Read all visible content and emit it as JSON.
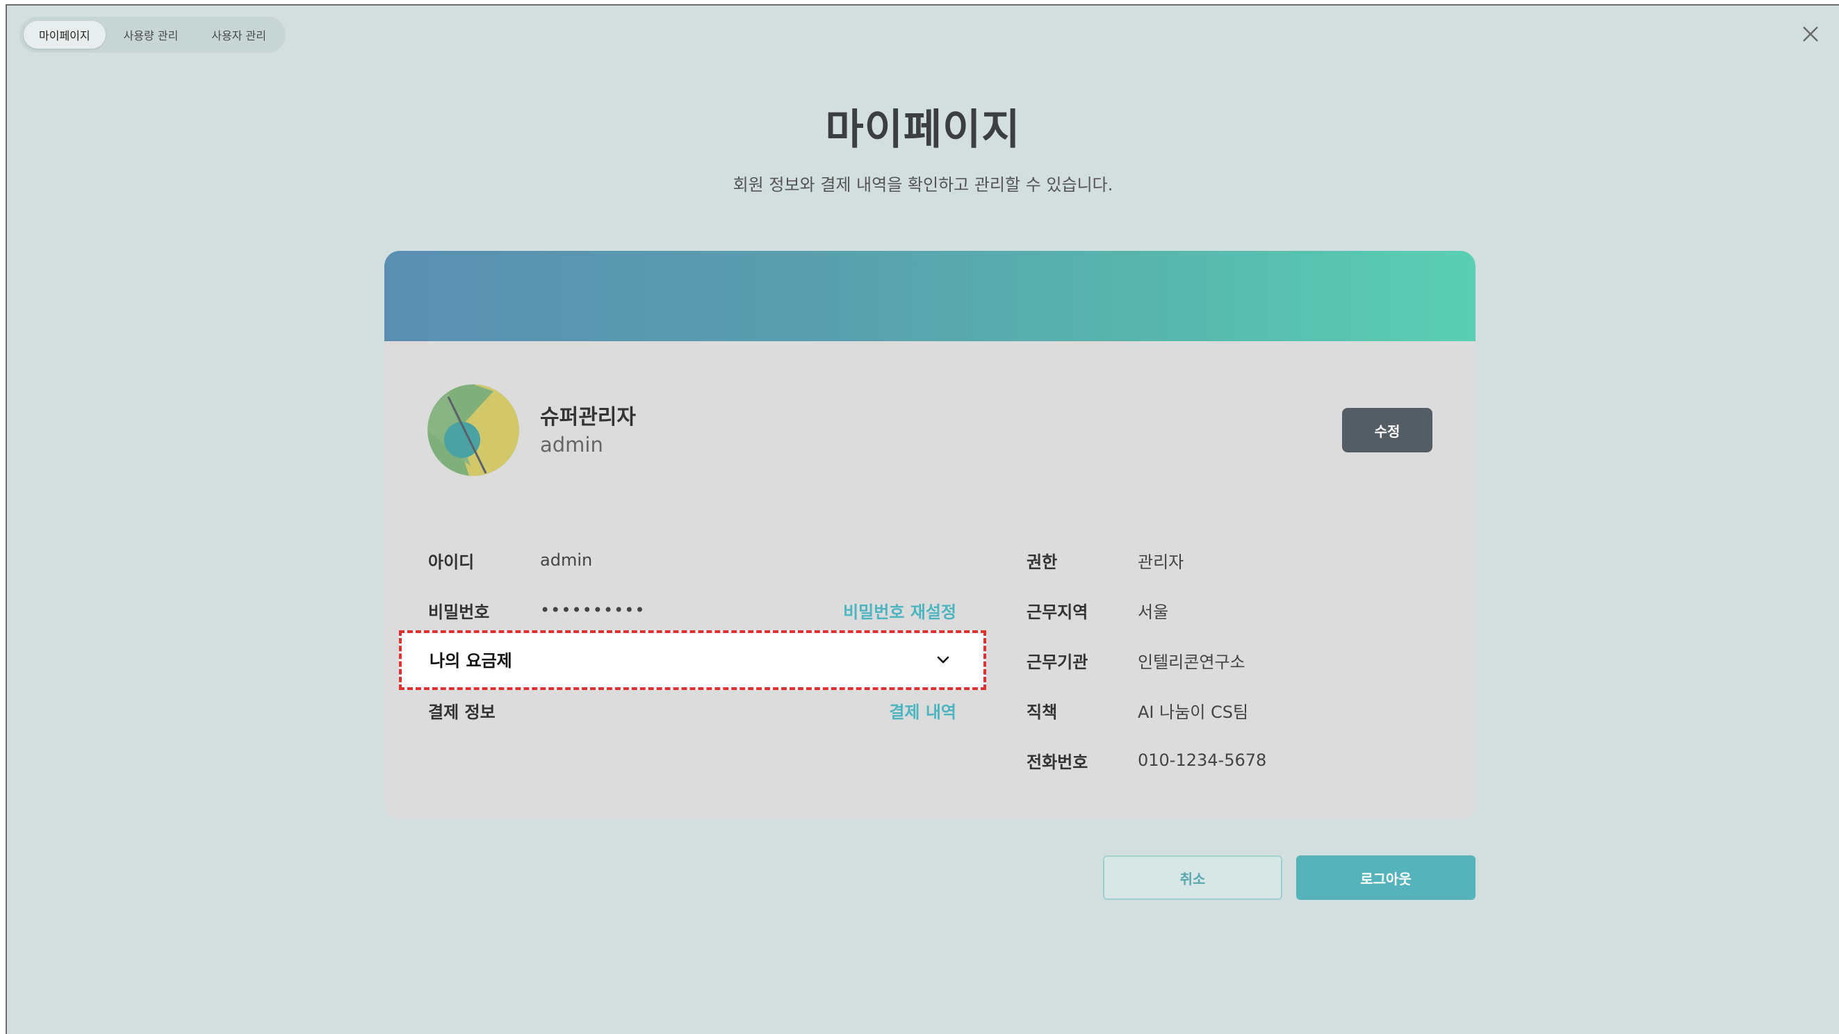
{
  "tabs": [
    {
      "label": "마이페이지",
      "active": true
    },
    {
      "label": "사용량 관리",
      "active": false
    },
    {
      "label": "사용자 관리",
      "active": false
    }
  ],
  "close_icon": "close-icon",
  "header": {
    "title": "마이페이지",
    "subtitle": "회원 정보와 결제 내역을 확인하고 관리할 수 있습니다."
  },
  "profile": {
    "name": "슈퍼관리자",
    "username": "admin",
    "edit_label": "수정"
  },
  "left_fields": {
    "id": {
      "label": "아이디",
      "value": "admin"
    },
    "password": {
      "label": "비밀번호",
      "value": "••••••••••",
      "action": "비밀번호 재설정"
    },
    "plan": {
      "label": "나의 요금제",
      "icon": "chevron-down-icon"
    },
    "payment": {
      "label": "결제 정보",
      "action": "결제 내역"
    }
  },
  "right_fields": [
    {
      "label": "권한",
      "value": "관리자"
    },
    {
      "label": "근무지역",
      "value": "서울"
    },
    {
      "label": "근무기관",
      "value": "인텔리콘연구소"
    },
    {
      "label": "직책",
      "value": "AI 나눔이 CS팀"
    },
    {
      "label": "전화번호",
      "value": "010-1234-5678"
    }
  ],
  "footer": {
    "cancel_label": "취소",
    "logout_label": "로그아웃"
  },
  "colors": {
    "background": "#d3dede",
    "card": "#dcdcdc",
    "accent": "#55b4bb",
    "banner_start": "#5b8fb2",
    "banner_end": "#5acfb3",
    "highlight_border": "#e03030"
  }
}
